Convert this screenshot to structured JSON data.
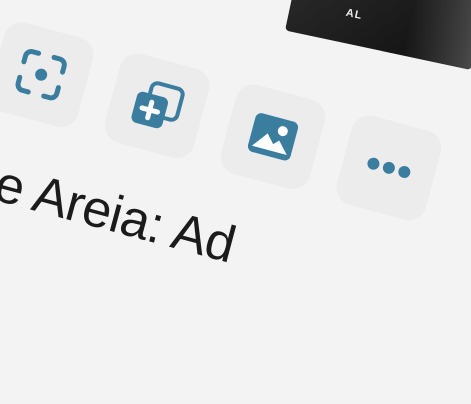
{
  "colors": {
    "accent": "#3b7d9f",
    "tile": "#ececec",
    "background": "#f3f3f3",
    "text": "#1b1b1b"
  },
  "thumbnail": {
    "caption": "AL"
  },
  "actions": [
    {
      "name": "lens",
      "icon": "focus-scan-icon"
    },
    {
      "name": "add-to-collection",
      "icon": "add-copy-icon"
    },
    {
      "name": "image",
      "icon": "image-icon"
    },
    {
      "name": "more",
      "icon": "more-dots-icon"
    }
  ],
  "title": {
    "text": "de Areia: Ad"
  }
}
